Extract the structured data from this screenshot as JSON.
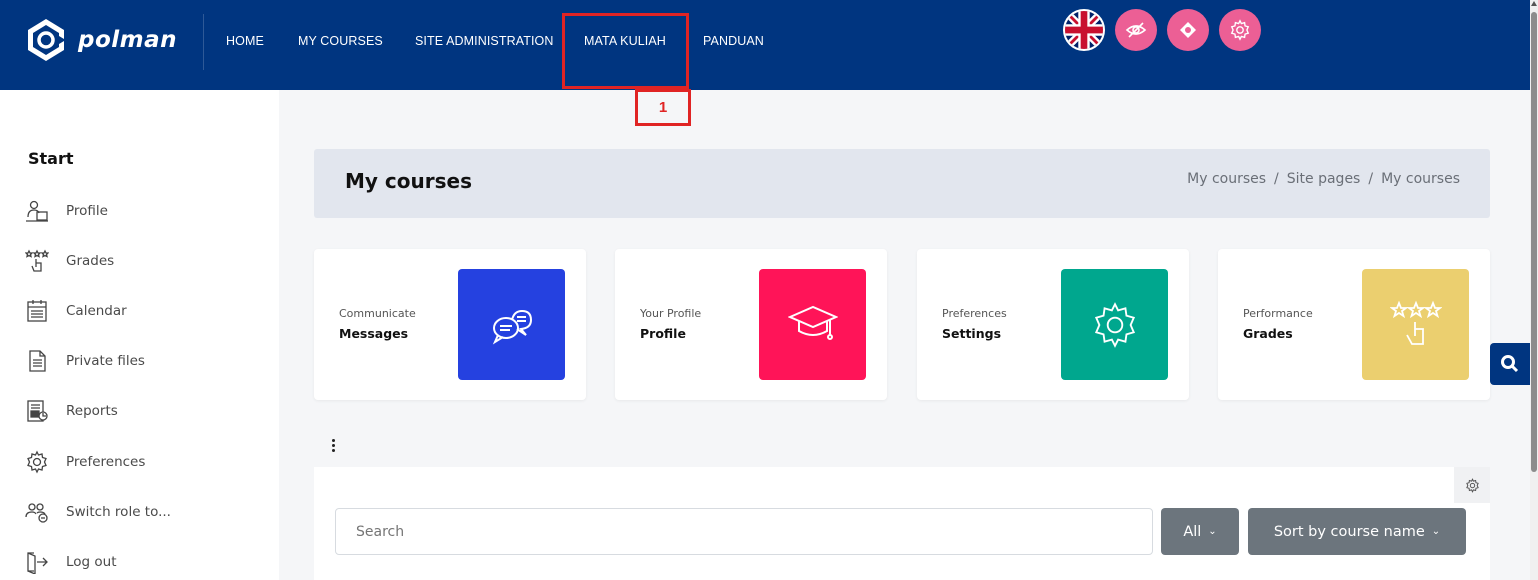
{
  "brand": {
    "name": "polman"
  },
  "nav": {
    "items": [
      {
        "label": "HOME"
      },
      {
        "label": "MY COURSES"
      },
      {
        "label": "SITE ADMINISTRATION"
      },
      {
        "label": "MATA KULIAH"
      },
      {
        "label": "PANDUAN"
      }
    ]
  },
  "top_icons": [
    "uk-flag-icon",
    "eye-slash-icon",
    "support-icon",
    "gear-icon"
  ],
  "annotation": {
    "number": "1"
  },
  "sidebar": {
    "title": "Start",
    "items": [
      {
        "label": "Profile",
        "icon": "profile-icon"
      },
      {
        "label": "Grades",
        "icon": "grades-icon"
      },
      {
        "label": "Calendar",
        "icon": "calendar-icon"
      },
      {
        "label": "Private files",
        "icon": "file-icon"
      },
      {
        "label": "Reports",
        "icon": "reports-icon"
      },
      {
        "label": "Preferences",
        "icon": "gear-icon"
      },
      {
        "label": "Switch role to...",
        "icon": "switch-role-icon"
      },
      {
        "label": "Log out",
        "icon": "logout-icon"
      }
    ]
  },
  "page": {
    "title": "My courses",
    "breadcrumb": [
      "My courses",
      "Site pages",
      "My courses"
    ]
  },
  "cards": [
    {
      "subtitle": "Communicate",
      "title": "Messages",
      "color": "#2541e0",
      "icon": "chat-icon"
    },
    {
      "subtitle": "Your Profile",
      "title": "Profile",
      "color": "#ff1458",
      "icon": "graduation-cap-icon"
    },
    {
      "subtitle": "Preferences",
      "title": "Settings",
      "color": "#00a78e",
      "icon": "gear-icon"
    },
    {
      "subtitle": "Performance",
      "title": "Grades",
      "color": "#ebcf6f",
      "icon": "grades-icon"
    }
  ],
  "course_overview": {
    "search_placeholder": "Search",
    "filter_label": "All",
    "sort_label": "Sort by course name"
  },
  "colors": {
    "header": "#003580",
    "accent_pink": "#ec5f95",
    "highlight": "#e02424"
  }
}
